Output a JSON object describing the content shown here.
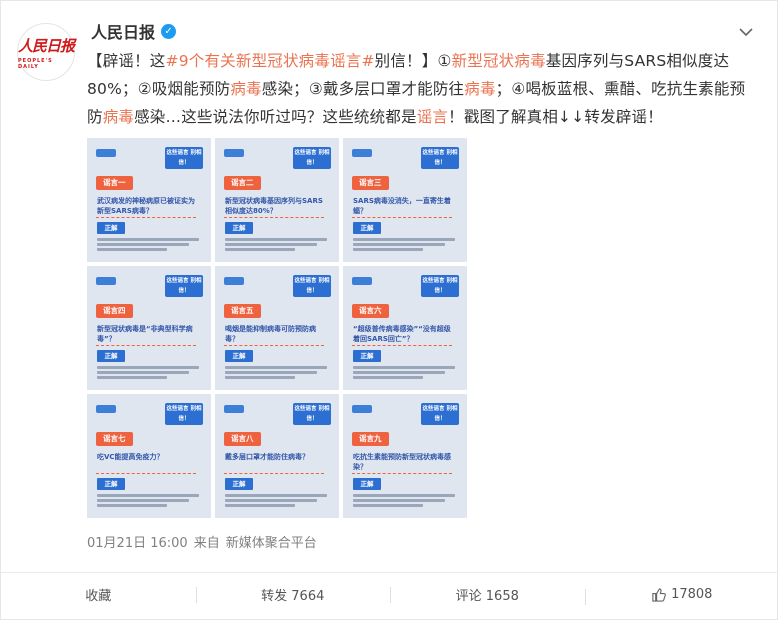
{
  "author": {
    "name": "人民日报",
    "logo_text": "人民日报",
    "logo_sub": "PEOPLE'S DAILY"
  },
  "post": {
    "segments": [
      {
        "text": "【辟谣！这",
        "hl": false
      },
      {
        "text": "#9个有关新型冠状病毒谣言#",
        "hl": true
      },
      {
        "text": "别信！】①",
        "hl": false
      },
      {
        "text": "新型冠状病毒",
        "hl": true
      },
      {
        "text": "基因序列与SARS相似度达80%；②吸烟能预防",
        "hl": false
      },
      {
        "text": "病毒",
        "hl": true
      },
      {
        "text": "感染；③戴多层口罩才能防往",
        "hl": false
      },
      {
        "text": "病毒",
        "hl": true
      },
      {
        "text": "；④喝板蓝根、熏醋、吃抗生素能预防",
        "hl": false
      },
      {
        "text": "病毒",
        "hl": true
      },
      {
        "text": "感染…这些说法你听过吗？这些统统都是",
        "hl": false
      },
      {
        "text": "谣言",
        "hl": true
      },
      {
        "text": "！戳图了解真相↓↓转发辟谣！",
        "hl": false
      }
    ]
  },
  "tiles": [
    {
      "label": "谣言一",
      "tag": "这些谣言 别相信！",
      "claim": "武汉病发的神秘病原已被证实为新型SARS病毒？",
      "correct": "正解"
    },
    {
      "label": "谣言二",
      "tag": "这些谣言 别相信！",
      "claim": "新型冠状病毒基因序列与SARS相似度达80%？",
      "correct": "正解"
    },
    {
      "label": "谣言三",
      "tag": "这些谣言 别相信！",
      "claim": "SARS病毒没消失，一直寄生着蝠？",
      "correct": "正解"
    },
    {
      "label": "谣言四",
      "tag": "这些谣言 别相信！",
      "claim": "新型冠状病毒是“非典型科学病毒”？",
      "correct": "正解"
    },
    {
      "label": "谣言五",
      "tag": "这些谣言 别相信！",
      "claim": "喝烟是能抑制病毒可防预防病毒？",
      "correct": "正解"
    },
    {
      "label": "谣言六",
      "tag": "这些谣言 别相信！",
      "claim": "“超级普传病毒感染”“没有超级着回SARS回亡”？",
      "correct": "正解"
    },
    {
      "label": "谣言七",
      "tag": "这些谣言 别相信！",
      "claim": "吃VC能提高免疫力？",
      "correct": "正解"
    },
    {
      "label": "谣言八",
      "tag": "这些谣言 别相信！",
      "claim": "戴多层口罩才能防住病毒？",
      "correct": "正解"
    },
    {
      "label": "谣言九",
      "tag": "这些谣言 别相信！",
      "claim": "吃抗生素能预防新型冠状病毒感染？",
      "correct": "正解"
    }
  ],
  "meta": {
    "time": "01月21日 16:00",
    "source_prefix": "来自",
    "source": "新媒体聚合平台"
  },
  "actions": {
    "favorite": "收藏",
    "repost": "转发 7664",
    "comment": "评论 1658",
    "like": "17808"
  },
  "colors": {
    "highlight": "#eb7350",
    "verified": "#1d9bf0",
    "brand_red": "#d0191b"
  }
}
